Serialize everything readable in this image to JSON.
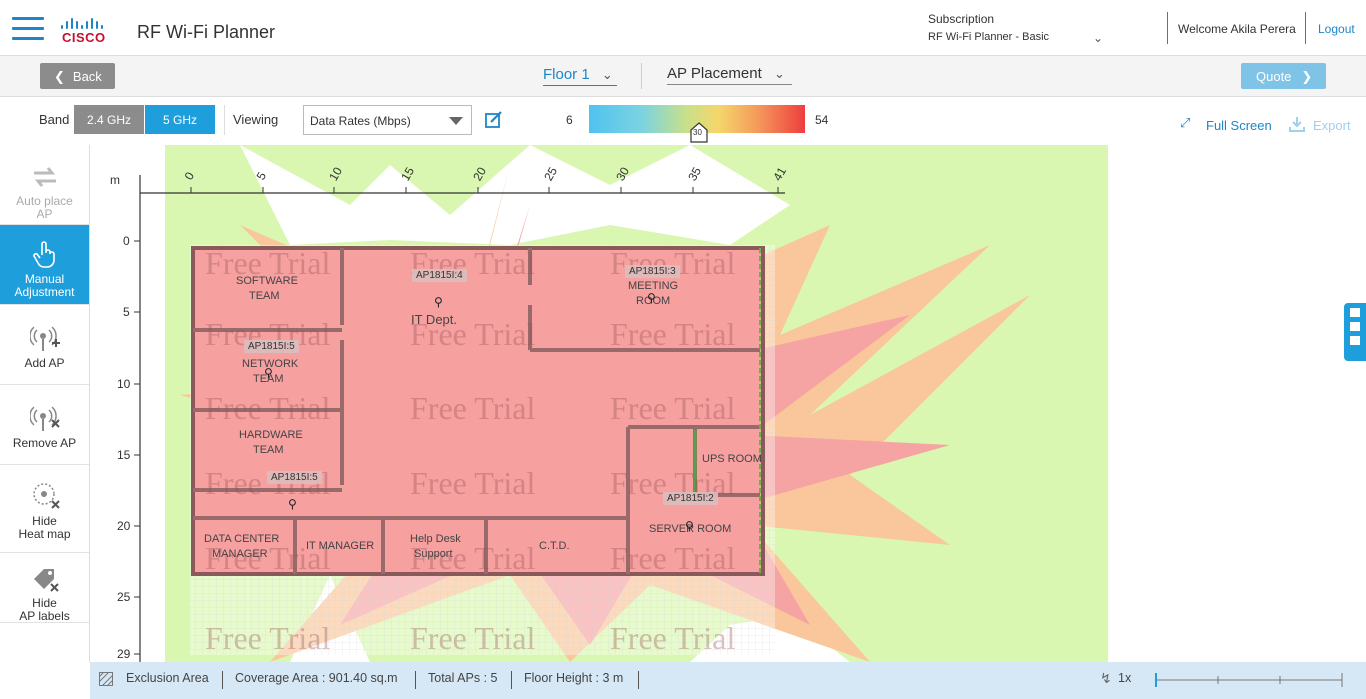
{
  "header": {
    "logo_text": "CISCO",
    "app_title": "RF Wi-Fi Planner",
    "subscription_label": "Subscription",
    "subscription_value": "RF Wi-Fi Planner - Basic",
    "welcome": "Welcome Akila Perera",
    "logout": "Logout"
  },
  "nav": {
    "back": "Back",
    "floor": "Floor 1",
    "mode": "AP Placement",
    "quote": "Quote"
  },
  "toolbar": {
    "band_label": "Band",
    "band_24": "2.4 GHz",
    "band_5": "5 GHz",
    "band_selected": "5 GHz",
    "viewing_label": "Viewing",
    "viewing_value": "Data Rates (Mbps)",
    "legend_min": "6",
    "legend_max": "54",
    "legend_marker": "30",
    "full_screen": "Full Screen",
    "export": "Export"
  },
  "sidebar": {
    "items": [
      {
        "label1": "Auto place",
        "label2": "AP",
        "state": "disabled"
      },
      {
        "label1": "Manual",
        "label2": "Adjustment",
        "state": "active"
      },
      {
        "label1": "Add AP",
        "label2": "",
        "state": "normal"
      },
      {
        "label1": "Remove AP",
        "label2": "",
        "state": "normal"
      },
      {
        "label1": "Hide",
        "label2": "Heat map",
        "state": "normal"
      },
      {
        "label1": "Hide",
        "label2": "AP labels",
        "state": "normal"
      }
    ]
  },
  "map": {
    "unit": "m",
    "x_ticks": [
      "0",
      "5",
      "10",
      "15",
      "20",
      "25",
      "30",
      "35",
      "41"
    ],
    "y_ticks": [
      "0",
      "5",
      "10",
      "15",
      "20",
      "25",
      "29"
    ],
    "watermark": "Free Trial",
    "rooms": [
      "SOFTWARE",
      "TEAM",
      "IT Dept.",
      "MEETING",
      "ROOM",
      "NETWORK",
      "TEAM",
      "HARDWARE",
      "TEAM",
      "UPS ROOM",
      "SERVER ROOM",
      "DATA CENTER",
      "MANAGER",
      "IT MANAGER",
      "Help Desk",
      "Support",
      "C.T.D."
    ],
    "aps": [
      "AP1815I:4",
      "AP1815I:3",
      "AP1815I:5",
      "AP1815I:5",
      "AP1815I:2"
    ]
  },
  "status": {
    "exclusion": "Exclusion Area",
    "coverage": "Coverage Area : 901.40  sq.m",
    "total_aps": "Total APs : 5",
    "floor_height": "Floor Height : 3 m",
    "zoom": "1x"
  },
  "colors": {
    "accent": "#1e9fdc",
    "link": "#1e86c8",
    "cisco_red": "#c8102e",
    "heat_green": "#d9f7b0",
    "heat_red": "#f4a0a0"
  }
}
